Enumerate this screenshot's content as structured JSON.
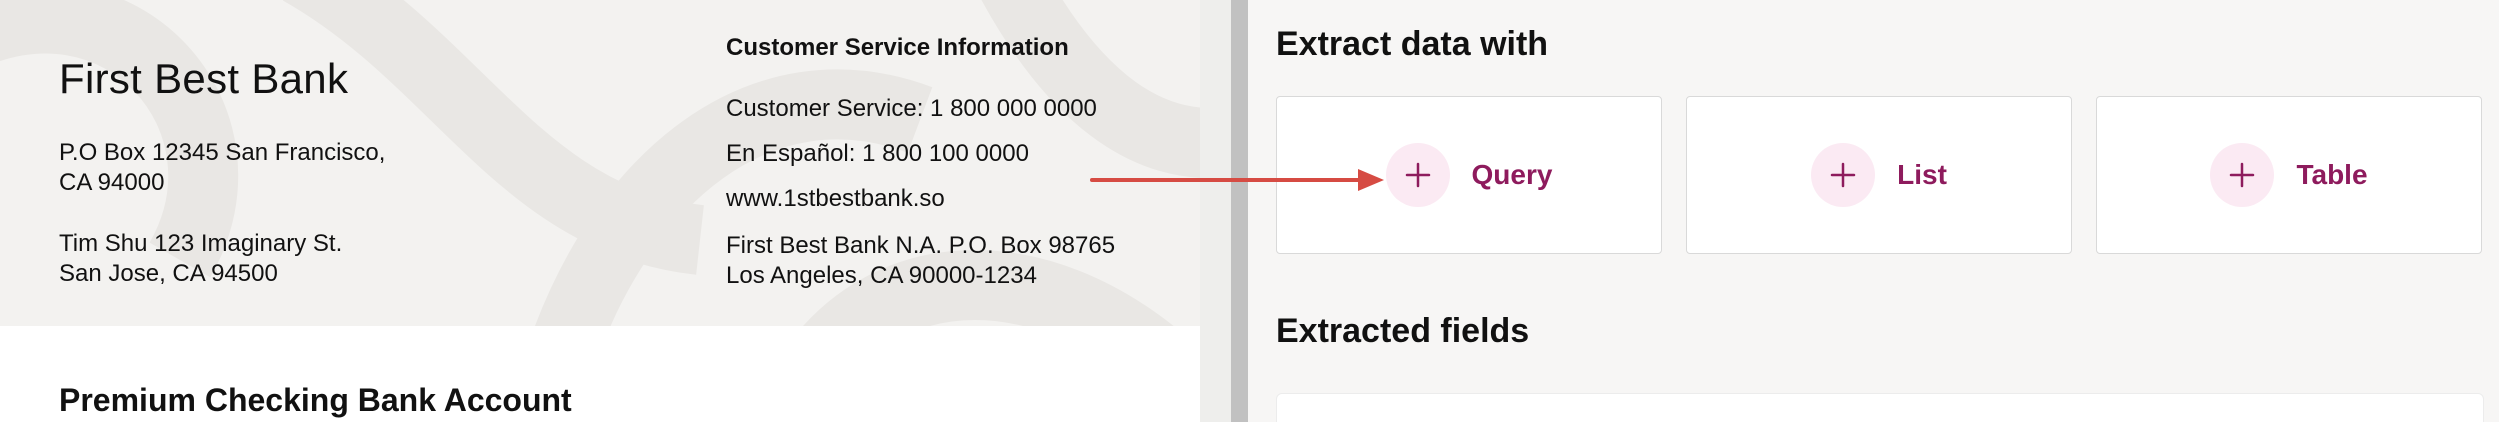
{
  "document": {
    "bank_name": "First Best Bank",
    "bank_address": [
      "P.O Box 12345 San Francisco,",
      "CA 94000"
    ],
    "customer_address": [
      "Tim Shu 123 Imaginary St.",
      "San Jose, CA 94500"
    ],
    "customer_service": {
      "title": "Customer Service Information",
      "phone": "Customer Service: 1 800 000 0000",
      "spanish": "En Español: 1 800 100 0000",
      "website": "www.1stbestbank.so",
      "mail": [
        "First Best Bank N.A. P.O. Box 98765",
        "Los Angeles, CA 90000-1234"
      ]
    },
    "section_title": "Premium Checking Bank Account"
  },
  "panel": {
    "extract_heading": "Extract data with",
    "options": [
      {
        "label": "Query",
        "icon": "plus-icon"
      },
      {
        "label": "List",
        "icon": "plus-icon"
      },
      {
        "label": "Table",
        "icon": "plus-icon"
      }
    ],
    "fields_heading": "Extracted fields"
  },
  "colors": {
    "accent": "#8e1b5d",
    "accent_bg": "#fbeaf3",
    "arrow": "#d64b43",
    "doc_header_bg": "#f3f2f0",
    "panel_bg": "#f7f6f5"
  }
}
